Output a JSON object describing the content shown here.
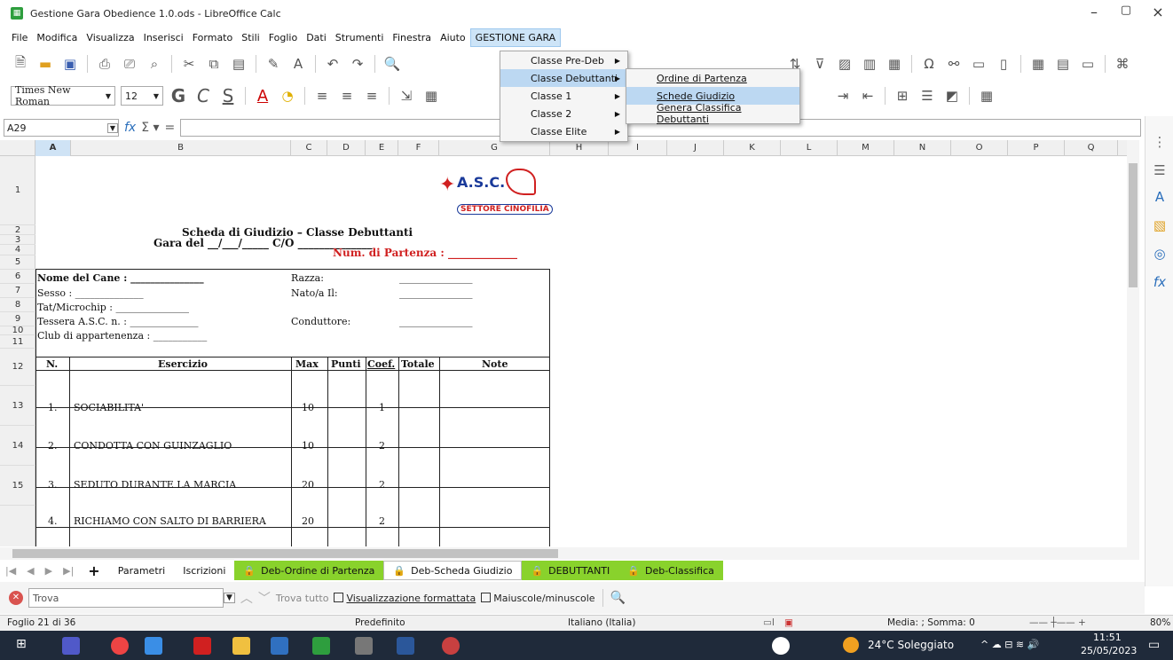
{
  "window": {
    "title": "Gestione Gara Obedience 1.0.ods - LibreOffice Calc",
    "min": "–",
    "max": "▢",
    "close": "×"
  },
  "menu": [
    "File",
    "Modifica",
    "Visualizza",
    "Inserisci",
    "Formato",
    "Stili",
    "Foglio",
    "Dati",
    "Strumenti",
    "Finestra",
    "Aiuto",
    "GESTIONE GARA"
  ],
  "toolbar2": {
    "font": "Times New Roman",
    "size": "12"
  },
  "formula": {
    "cell": "A29"
  },
  "columns": [
    "A",
    "B",
    "C",
    "D",
    "E",
    "F",
    "G",
    "H",
    "I",
    "J",
    "K",
    "L",
    "M",
    "N",
    "O",
    "P",
    "Q"
  ],
  "rows": [
    "1",
    "2",
    "3",
    "4",
    "5",
    "6",
    "7",
    "8",
    "9",
    "10",
    "11",
    "12",
    "13",
    "14",
    "15"
  ],
  "sheet": {
    "logo_top": "A.S.C.",
    "logo_bottom": "SETTORE CINOFILIA",
    "heading": "Scheda di Giudizio – Classe Debuttanti",
    "gara": "Gara del __/___/_____ C/O ______________",
    "partenza": "Num. di Partenza : _____________",
    "nome_cane": "Nome del Cane : _______________",
    "razza": "Razza:",
    "sesso": "Sesso : ______________",
    "nato": "Nato/a Il:",
    "tat": "Tat/Microchip : _______________",
    "tessera": "Tessera A.S.C. n. : ______________",
    "conduttore": "Conduttore:",
    "club": "Club di appartenenza : ___________",
    "blank_line": "_______________",
    "table_headers": {
      "n": "N.",
      "esercizio": "Esercizio",
      "max": "Max",
      "punti": "Punti",
      "coef": "Coef.",
      "totale": "Totale",
      "note": "Note"
    },
    "exercises": [
      {
        "n": "1.",
        "name": "SOCIABILITA'",
        "max": "10",
        "coef": "1"
      },
      {
        "n": "2.",
        "name": "CONDOTTA CON GUINZAGLIO",
        "max": "10",
        "coef": "2"
      },
      {
        "n": "3.",
        "name": "SEDUTO DURANTE LA MARCIA",
        "max": "20",
        "coef": "2"
      },
      {
        "n": "4.",
        "name": "RICHIAMO CON SALTO DI BARRIERA",
        "max": "20",
        "coef": "2"
      }
    ]
  },
  "dropdown1": [
    "Classe Pre-Deb",
    "Classe Debuttanti",
    "Classe 1",
    "Classe 2",
    "Classe Elite"
  ],
  "dropdown2": [
    "Ordine di Partenza",
    "Schede Giudizio",
    "Genera Classifica Debuttanti"
  ],
  "tabs": {
    "plus": "+",
    "items": [
      "Parametri",
      "Iscrizioni",
      "Deb-Ordine di Partenza",
      "Deb-Scheda Giudizio",
      "DEBUTTANTI",
      "Deb-Classifica"
    ]
  },
  "find": {
    "placeholder": "Trova",
    "find_all": "Trova tutto",
    "formatted": "Visualizzazione formattata",
    "case": "Maiuscole/minuscole"
  },
  "status": {
    "sheet": "Foglio 21 di 36",
    "style": "Predefinito",
    "lang": "Italiano (Italia)",
    "sum": "Media: ; Somma: 0",
    "zoom": "80%"
  },
  "taskbar": {
    "weather": "24°C Soleggiato",
    "time": "11:51",
    "date": "25/05/2023"
  }
}
